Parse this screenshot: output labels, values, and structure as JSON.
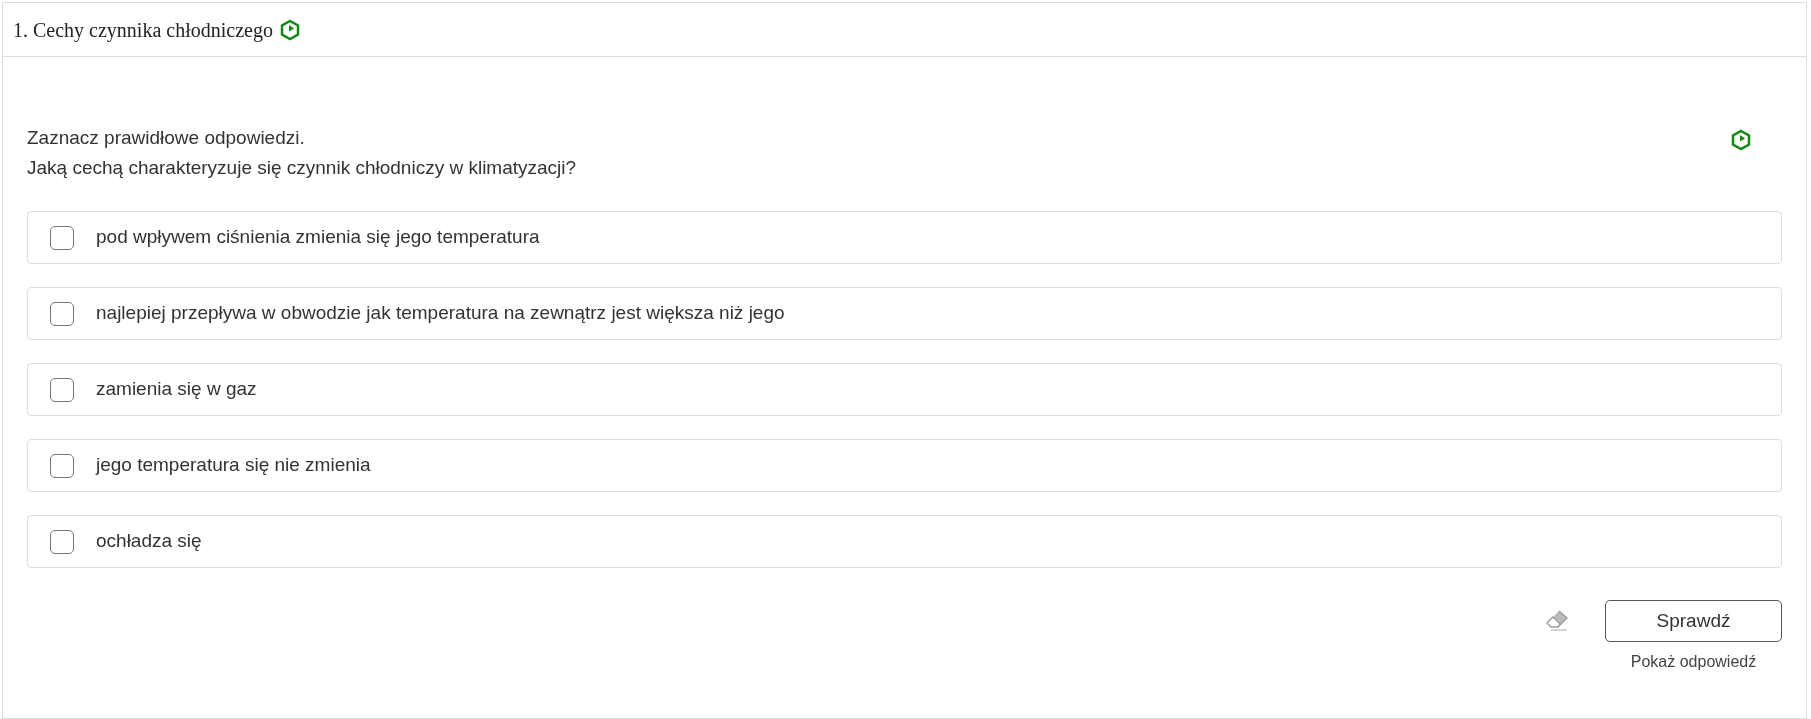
{
  "title": "1. Cechy czynnika chłodniczego",
  "instructions": [
    "Zaznacz prawidłowe odpowiedzi.",
    "Jaką cechą charakteryzuje się czynnik chłodniczy w klimatyzacji?"
  ],
  "options": [
    {
      "label": "pod wpływem ciśnienia zmienia się jego temperatura",
      "checked": false
    },
    {
      "label": "najlepiej przepływa w obwodzie jak temperatura na zewnątrz jest większa niż jego",
      "checked": false
    },
    {
      "label": "zamienia się w gaz",
      "checked": false
    },
    {
      "label": "jego temperatura się nie zmienia",
      "checked": false
    },
    {
      "label": "ochładza się",
      "checked": false
    }
  ],
  "check_button": "Sprawdź",
  "show_answer_link": "Pokaż odpowiedź"
}
